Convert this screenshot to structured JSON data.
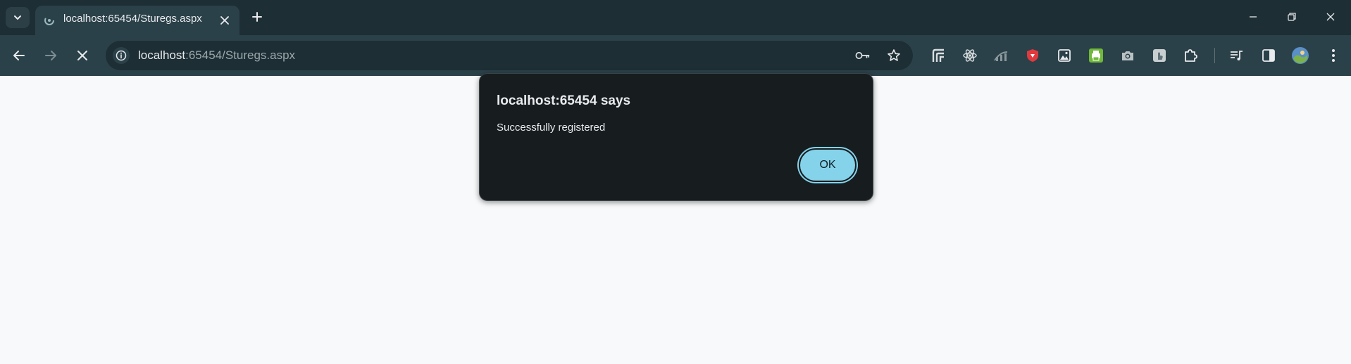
{
  "browser": {
    "tab": {
      "title": "localhost:65454/Sturegs.aspx",
      "favicon": "loading-spinner-icon"
    },
    "address_bar": {
      "url_host": "localhost",
      "url_rest": ":65454/Sturegs.aspx"
    },
    "accent_color": "#84d3ea",
    "frame_color": "#1d2e34",
    "toolbar_color": "#2b4149"
  },
  "dialog": {
    "title": "localhost:65454 says",
    "message": "Successfully registered",
    "ok_label": "OK"
  }
}
